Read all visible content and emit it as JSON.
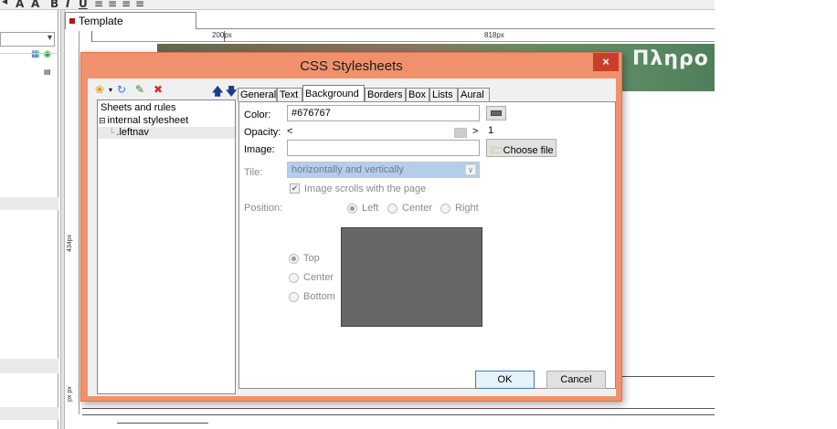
{
  "toolbar": {
    "glyphs": [
      "A",
      "A",
      "B",
      "I",
      "U"
    ]
  },
  "left_panel": {
    "dropdown_chevron": "▾"
  },
  "document_tab": {
    "label": "Template"
  },
  "rulers": {
    "left_width_label": "200px",
    "content_width_label": "818px",
    "height_label": "434px",
    "bottom_label": "px px"
  },
  "banner": {
    "text": "Πληρο"
  },
  "dialog": {
    "title": "CSS Stylesheets",
    "close_label": "×",
    "tree": {
      "header": "Sheets and rules",
      "nodes": [
        {
          "label": "internal stylesheet",
          "expander": "⊟"
        },
        {
          "label": ".leftnav",
          "expander": "└"
        }
      ]
    },
    "tabs": [
      "General",
      "Text",
      "Background",
      "Borders",
      "Box",
      "Lists",
      "Aural"
    ],
    "active_tab": "Background",
    "background": {
      "color_label": "Color:",
      "color_value": "#676767",
      "opacity_label": "Opacity:",
      "opacity_less": "<",
      "opacity_more": ">",
      "opacity_value": "1",
      "image_label": "Image:",
      "image_value": "",
      "choose_file_label": "Choose file",
      "tile_label": "Tile:",
      "tile_value": "horizontally and vertically",
      "scroll_checkbox_label": "Image scrolls with the page",
      "scroll_checked": true,
      "position_label": "Position:",
      "horizontal_options": [
        "Left",
        "Center",
        "Right"
      ],
      "horizontal_selected": "Left",
      "vertical_options": [
        "Top",
        "Center",
        "Bottom"
      ],
      "vertical_selected": "Top",
      "preview_color": "#676767"
    },
    "ok_label": "OK",
    "cancel_label": "Cancel"
  },
  "colors": {
    "dialog_frame": "#f0916b",
    "close_button": "#c7402d",
    "tile_select_bg": "#b4cdea"
  }
}
